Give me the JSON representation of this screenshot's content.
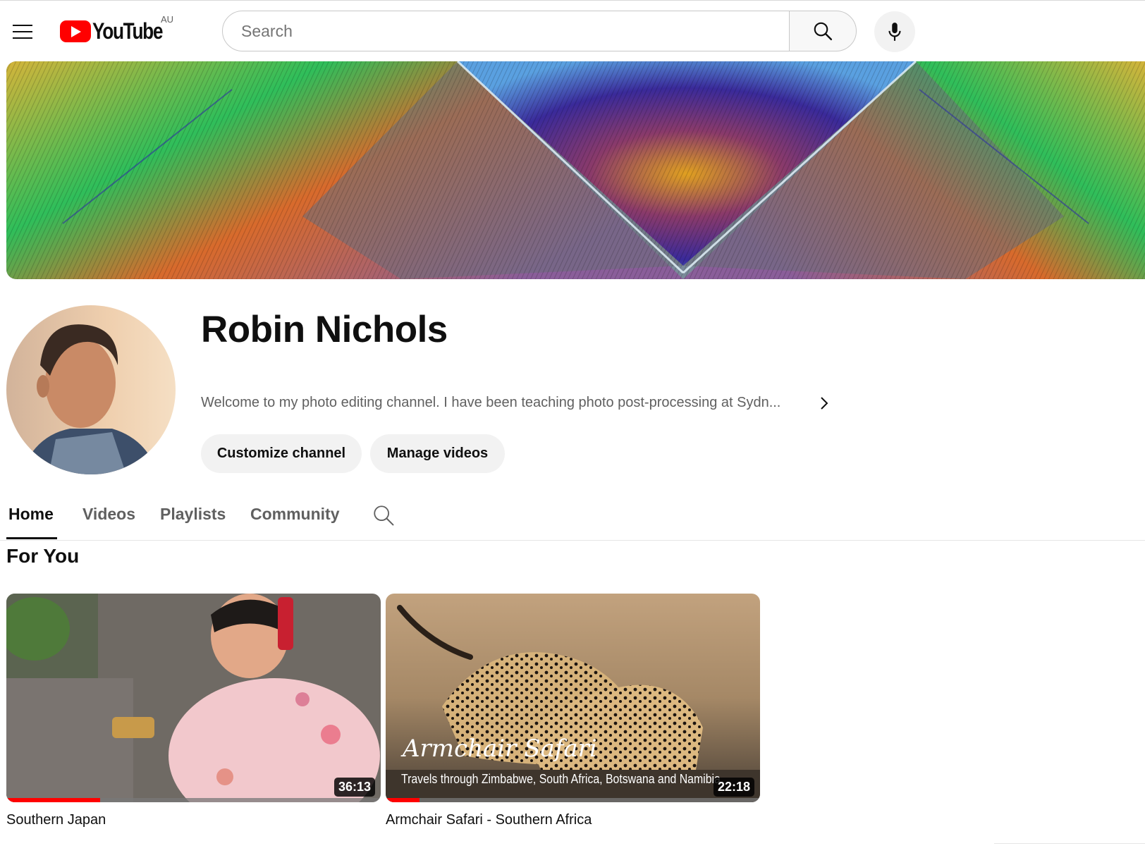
{
  "header": {
    "logo_text": "YouTube",
    "country_code": "AU",
    "search_placeholder": "Search"
  },
  "channel": {
    "name": "Robin Nichols",
    "description": "Welcome to my photo editing channel. I have been teaching photo post-processing at Sydn...",
    "buttons": {
      "customize": "Customize channel",
      "manage": "Manage videos"
    }
  },
  "tabs": [
    {
      "label": "Home",
      "active": true
    },
    {
      "label": "Videos",
      "active": false
    },
    {
      "label": "Playlists",
      "active": false
    },
    {
      "label": "Community",
      "active": false
    }
  ],
  "section": {
    "title": "For You"
  },
  "videos": [
    {
      "title": "Southern Japan",
      "duration": "36:13",
      "watched_fraction": 0.25
    },
    {
      "title": "Armchair Safari - Southern Africa",
      "duration": "22:18",
      "watched_fraction": 0.09,
      "thumb_title": "Armchair Safari",
      "thumb_subtitle": "Travels through Zimbabwe, South Africa, Botswana and Namibia"
    }
  ],
  "colors": {
    "brand_red": "#ff0000",
    "text_primary": "#0f0f0f",
    "text_secondary": "#606060",
    "chip_background": "#f2f2f2"
  },
  "icons": [
    "menu-icon",
    "youtube-logo-icon",
    "search-icon",
    "microphone-icon",
    "chevron-right-icon",
    "channel-search-icon"
  ]
}
